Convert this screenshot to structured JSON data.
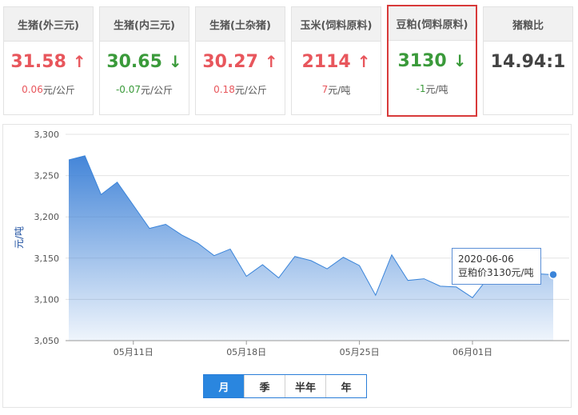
{
  "cards": [
    {
      "title": "生猪(外三元)",
      "price": "31.58",
      "change": "0.06",
      "unit": "元/公斤",
      "dir": "up"
    },
    {
      "title": "生猪(内三元)",
      "price": "30.65",
      "change": "-0.07",
      "unit": "元/公斤",
      "dir": "down"
    },
    {
      "title": "生猪(土杂猪)",
      "price": "30.27",
      "change": "0.18",
      "unit": "元/公斤",
      "dir": "up"
    },
    {
      "title": "玉米(饲料原料)",
      "price": "2114",
      "change": "7",
      "unit": "元/吨",
      "dir": "up"
    },
    {
      "title": "豆粕(饲料原料)",
      "price": "3130",
      "change": "-1",
      "unit": "元/吨",
      "dir": "down"
    },
    {
      "title": "猪粮比",
      "price": "14.94:1"
    }
  ],
  "colors": {
    "up": "#e8565c",
    "down": "#3a9a3a",
    "series": "#3a84d9",
    "selected_border": "#d83a3a"
  },
  "tooltip": {
    "date": "2020-06-06",
    "text": "豆粕价3130元/吨"
  },
  "tabs": [
    {
      "label": "月",
      "active": true
    },
    {
      "label": "季",
      "active": false
    },
    {
      "label": "半年",
      "active": false
    },
    {
      "label": "年",
      "active": false
    }
  ],
  "chart_data": {
    "type": "area",
    "ylabel": "元/吨",
    "ylim": [
      3050,
      3300
    ],
    "yticks": [
      3050,
      3100,
      3150,
      3200,
      3250,
      3300
    ],
    "ytick_labels": [
      "3,050",
      "3,100",
      "3,150",
      "3,200",
      "3,250",
      "3,300"
    ],
    "xticks": [
      {
        "date": "2020-05-11",
        "label": "05月11日"
      },
      {
        "date": "2020-05-18",
        "label": "05月18日"
      },
      {
        "date": "2020-05-25",
        "label": "05月25日"
      },
      {
        "date": "2020-06-01",
        "label": "06月01日"
      }
    ],
    "grid": true,
    "series": [
      {
        "dates": [
          "2020-05-07",
          "2020-05-08",
          "2020-05-09",
          "2020-05-10",
          "2020-05-11",
          "2020-05-12",
          "2020-05-13",
          "2020-05-14",
          "2020-05-15",
          "2020-05-16",
          "2020-05-17",
          "2020-05-18",
          "2020-05-19",
          "2020-05-20",
          "2020-05-21",
          "2020-05-22",
          "2020-05-23",
          "2020-05-24",
          "2020-05-25",
          "2020-05-26",
          "2020-05-27",
          "2020-05-28",
          "2020-05-29",
          "2020-05-30",
          "2020-05-31",
          "2020-06-01",
          "2020-06-02",
          "2020-06-03",
          "2020-06-04",
          "2020-06-05",
          "2020-06-06"
        ],
        "values": [
          3269,
          3274,
          3227,
          3242,
          3214,
          3186,
          3191,
          3178,
          3168,
          3153,
          3161,
          3128,
          3142,
          3126,
          3152,
          3147,
          3137,
          3151,
          3141,
          3105,
          3154,
          3123,
          3125,
          3116,
          3115,
          3102,
          3127,
          3130,
          3131,
          3131,
          3130
        ]
      }
    ]
  }
}
